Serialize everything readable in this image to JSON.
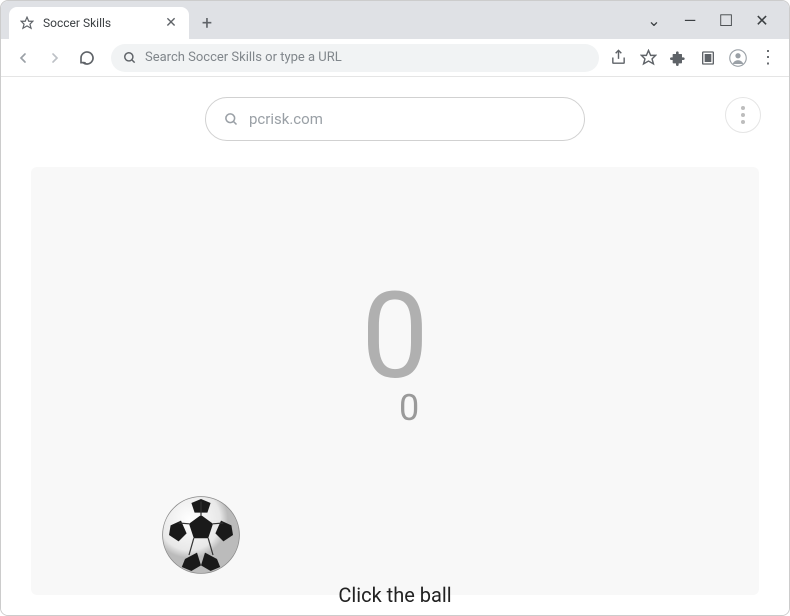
{
  "window": {
    "tab_title": "Soccer Skills"
  },
  "toolbar": {
    "omnibox_placeholder": "Search Soccer Skills or type a URL"
  },
  "page": {
    "search_placeholder": "pcrisk.com",
    "score_big": "0",
    "score_small": "0",
    "instruction": "Click the ball",
    "watermark_text": "PCrisk.com"
  },
  "icons": {
    "back": "←",
    "forward": "→",
    "reload": "⟳",
    "share": "↗",
    "star": "☆",
    "puzzle": "✦",
    "reader": "▣",
    "profile": "👤",
    "menu": "⋮",
    "close": "✕",
    "plus": "+",
    "chevron": "⌄",
    "minimize": "—",
    "maximize": "☐",
    "win_close": "✕"
  }
}
